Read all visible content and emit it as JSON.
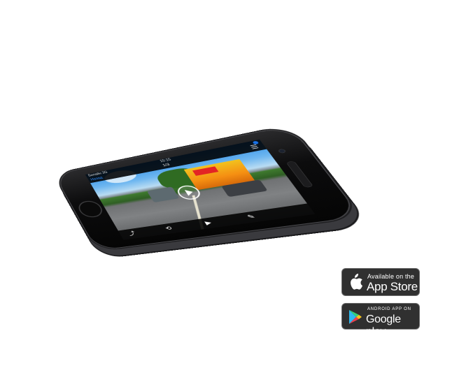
{
  "phone": {
    "status": {
      "carrier": "Билайн 3G",
      "time": "15:15"
    },
    "counter": "1/3",
    "back_label": "Назад"
  },
  "badges": {
    "app_store": {
      "small": "Available on the",
      "large": "App Store"
    },
    "google_play": {
      "small": "ANDROID APP ON",
      "large": "Google play"
    }
  },
  "colors": {
    "badge_bg": "#303030",
    "accent_blue": "#2d8cff"
  }
}
